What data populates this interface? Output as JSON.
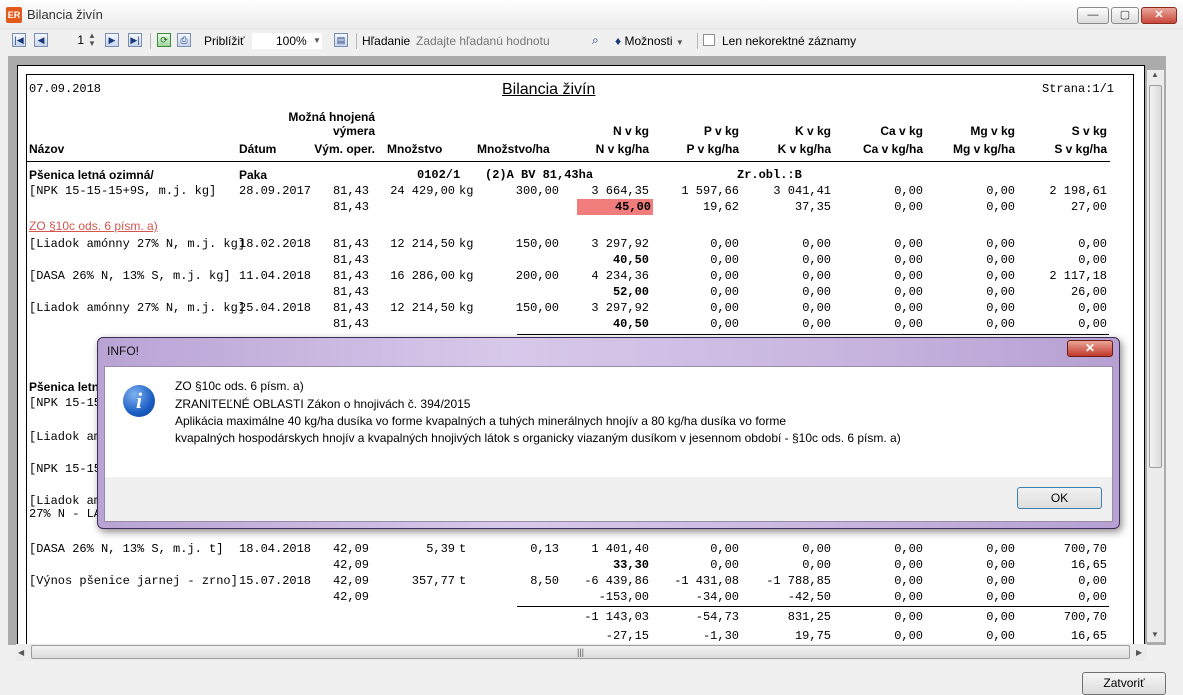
{
  "window": {
    "title": "Bilancia živín",
    "icon": "app-icon",
    "minimize": "—",
    "maximize": "▢",
    "close": "✕"
  },
  "toolbar": {
    "page_number": "1",
    "zoom_label": "Priblížiť",
    "zoom_value": "100%",
    "search_label": "Hľadanie",
    "search_placeholder": "Zadajte hľadanú hodnotu",
    "options_label": "Možnosti",
    "only_incorrect_label": "Len nekorektné záznamy"
  },
  "report": {
    "date": "07.09.2018",
    "title": "Bilancia živín",
    "page": "Strana:1/1",
    "headers": {
      "name": "Názov",
      "date": "Dátum",
      "area_top1": "Možná hnojená",
      "area_top2": "výmera",
      "area": "Vým. oper.",
      "amount": "Množstvo",
      "amount_ha": "Množstvo/ha",
      "n_top": "N v kg",
      "n": "N v kg/ha",
      "p_top": "P v kg",
      "p": "P v kg/ha",
      "k_top": "K v kg",
      "k": "K v kg/ha",
      "ca_top": "Ca v kg",
      "ca": "Ca v kg/ha",
      "mg_top": "Mg v kg",
      "mg": "Mg v kg/ha",
      "s_top": "S v kg",
      "s": "S v kg/ha"
    },
    "block1": {
      "crop": "Pšenica letná ozimná/",
      "place": "Paka",
      "parcel": "0102/1",
      "code": "(2)A BV 81,43ha",
      "zone": "Zr.obl.:B"
    },
    "rows": [
      {
        "name": "[NPK 15-15-15+9S, m.j. kg]",
        "date": "28.09.2017",
        "area": "81,43",
        "amount": "24 429,00",
        "unit": "kg",
        "amount_ha": "300,00",
        "n": "3 664,35",
        "p": "1 597,66",
        "k": "3 041,41",
        "ca": "0,00",
        "mg": "0,00",
        "s": "2 198,61",
        "area2": "81,43",
        "n2": "45,00",
        "p2": "19,62",
        "k2": "37,35",
        "ca2": "0,00",
        "mg2": "0,00",
        "s2": "27,00"
      },
      {
        "name": "[Liadok amónny 27% N, m.j. kg]",
        "date": "18.02.2018",
        "area": "81,43",
        "amount": "12 214,50",
        "unit": "kg",
        "amount_ha": "150,00",
        "n": "3 297,92",
        "p": "0,00",
        "k": "0,00",
        "ca": "0,00",
        "mg": "0,00",
        "s": "0,00",
        "area2": "81,43",
        "n2": "40,50",
        "p2": "0,00",
        "k2": "0,00",
        "ca2": "0,00",
        "mg2": "0,00",
        "s2": "0,00"
      },
      {
        "name": "[DASA 26% N, 13% S, m.j. kg]",
        "date": "11.04.2018",
        "area": "81,43",
        "amount": "16 286,00",
        "unit": "kg",
        "amount_ha": "200,00",
        "n": "4 234,36",
        "p": "0,00",
        "k": "0,00",
        "ca": "0,00",
        "mg": "0,00",
        "s": "2 117,18",
        "area2": "81,43",
        "n2": "52,00",
        "p2": "0,00",
        "k2": "0,00",
        "ca2": "0,00",
        "mg2": "0,00",
        "s2": "26,00"
      },
      {
        "name": "[Liadok amónny 27% N, m.j. kg]",
        "date": "25.04.2018",
        "area": "81,43",
        "amount": "12 214,50",
        "unit": "kg",
        "amount_ha": "150,00",
        "n": "3 297,92",
        "p": "0,00",
        "k": "0,00",
        "ca": "0,00",
        "mg": "0,00",
        "s": "0,00",
        "area2": "81,43",
        "n2": "40,50",
        "p2": "0,00",
        "k2": "0,00",
        "ca2": "0,00",
        "mg2": "0,00",
        "s2": "0,00"
      }
    ],
    "violation_link": "ZO §10c ods. 6 písm. a)",
    "block2": {
      "crop": "Pšenica letn",
      "item1": "[NPK 15-15-",
      "item2": "[Liadok amó",
      "item3": "[NPK 15-15-",
      "item4a": "[Liadok amó",
      "item4b": "27% N - LAV"
    },
    "rows2": [
      {
        "name": "[DASA 26% N, 13% S, m.j. t]",
        "date": "18.04.2018",
        "area": "42,09",
        "amount": "5,39",
        "unit": "t",
        "amount_ha": "0,13",
        "n": "1 401,40",
        "p": "0,00",
        "k": "0,00",
        "ca": "0,00",
        "mg": "0,00",
        "s": "700,70",
        "area2": "42,09",
        "n2": "33,30",
        "p2": "0,00",
        "k2": "0,00",
        "ca2": "0,00",
        "mg2": "0,00",
        "s2": "16,65"
      },
      {
        "name": "[Výnos pšenice jarnej - zrno]",
        "date": "15.07.2018",
        "area": "42,09",
        "amount": "357,77",
        "unit": "t",
        "amount_ha": "8,50",
        "n": "-6 439,86",
        "p": "-1 431,08",
        "k": "-1 788,85",
        "ca": "0,00",
        "mg": "0,00",
        "s": "0,00",
        "area2": "42,09",
        "n2": "-153,00",
        "p2": "-34,00",
        "k2": "-42,50",
        "ca2": "0,00",
        "mg2": "0,00",
        "s2": "0,00"
      }
    ],
    "totals": {
      "n": "-1 143,03",
      "p": "-54,73",
      "k": "831,25",
      "ca": "0,00",
      "mg": "0,00",
      "s": "700,70",
      "n2": "-27,15",
      "p2": "-1,30",
      "k2": "19,75",
      "ca2": "0,00",
      "mg2": "0,00",
      "s2": "16,65"
    }
  },
  "dialog": {
    "title": "INFO!",
    "close": "✕",
    "icon": "info-icon",
    "line1": "ZO §10c ods. 6 písm. a)",
    "line2": "ZRANITEĽNÉ OBLASTI Zákon o hnojivách č. 394/2015",
    "line3": "Aplikácia maximálne 40 kg/ha dusíka vo forme kvapalných a tuhých minerálnych hnojív a 80 kg/ha dusíka vo forme",
    "line4": "kvapalných hospodárskych hnojív a kvapalných hnojivých látok s organicky viazaným dusíkom v jesennom období - §10c ods. 6 písm. a)",
    "ok": "OK"
  },
  "footer": {
    "close_button": "Zatvoriť"
  },
  "colors": {
    "highlight": "#f07c7c",
    "link": "#d4554e",
    "dialog_frame": "#c9b7e0"
  }
}
